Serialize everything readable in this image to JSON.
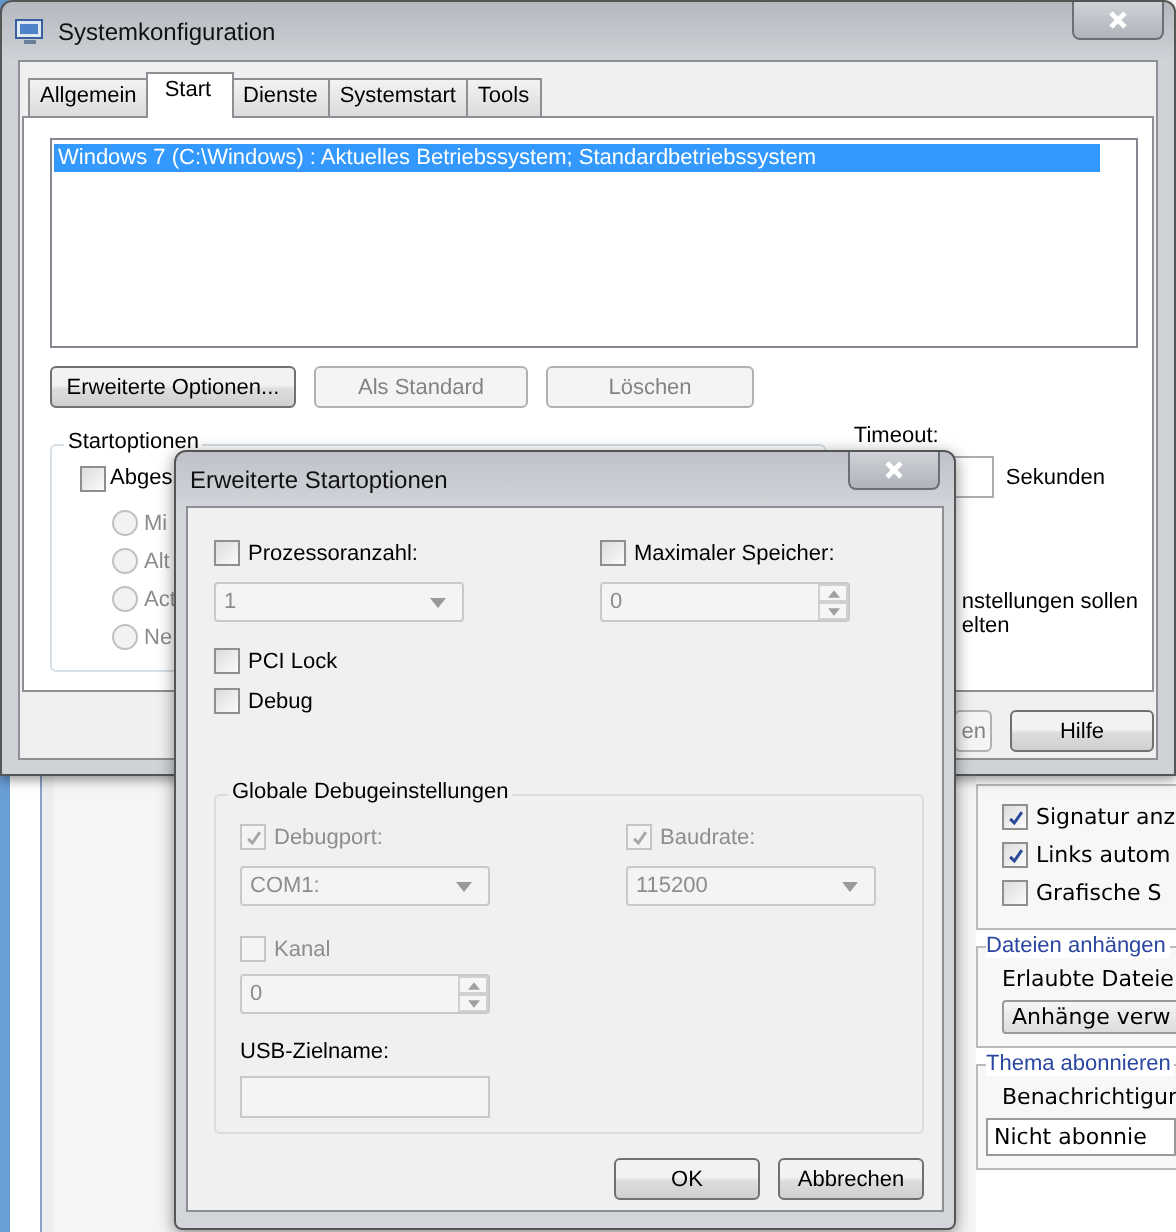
{
  "main_window": {
    "title": "Systemkonfiguration",
    "tabs": [
      {
        "label": "Allgemein",
        "selected": false
      },
      {
        "label": "Start",
        "selected": true
      },
      {
        "label": "Dienste",
        "selected": false
      },
      {
        "label": "Systemstart",
        "selected": false
      },
      {
        "label": "Tools",
        "selected": false
      }
    ],
    "boot_list": [
      {
        "text": "Windows 7 (C:\\Windows) : Aktuelles Betriebssystem; Standardbetriebssystem",
        "selected": true
      }
    ],
    "list_buttons": [
      {
        "label": "Erweiterte Optionen...",
        "disabled": false
      },
      {
        "label": "Als Standard",
        "disabled": true
      },
      {
        "label": "Löschen",
        "disabled": true
      }
    ],
    "boot_options": {
      "title": "Startoptionen",
      "safe_boot": {
        "label": "Abges",
        "checked": false
      },
      "modes": [
        {
          "label": "Mi",
          "selected": false,
          "disabled": true
        },
        {
          "label": "Alt",
          "selected": false,
          "disabled": true
        },
        {
          "label": "Act",
          "selected": false,
          "disabled": true
        },
        {
          "label": "Ne",
          "selected": false,
          "disabled": true
        }
      ]
    },
    "timeout": {
      "label": "Timeout:",
      "unit": "Sekunden"
    },
    "persist_note": [
      "nstellungen sollen",
      "elten"
    ],
    "buttons": [
      {
        "label": "en",
        "disabled": true
      },
      {
        "label": "Hilfe",
        "disabled": false
      }
    ]
  },
  "dialog": {
    "title": "Erweiterte Startoptionen",
    "processor": {
      "label": "Prozessoranzahl:",
      "checked": false,
      "value": "1",
      "disabled": true
    },
    "memory": {
      "label": "Maximaler Speicher:",
      "checked": false,
      "value": "0",
      "disabled": true
    },
    "flags": [
      {
        "label": "PCI Lock",
        "checked": false
      },
      {
        "label": "Debug",
        "checked": false
      }
    ],
    "debug_settings": {
      "title": "Globale Debugeinstellungen",
      "debugport": {
        "label": "Debugport:",
        "checked": true,
        "disabled": true,
        "value": "COM1:"
      },
      "baudrate": {
        "label": "Baudrate:",
        "checked": true,
        "disabled": true,
        "value": "115200"
      },
      "channel": {
        "label": "Kanal",
        "checked": false,
        "disabled": true,
        "value": "0"
      },
      "usb_target": {
        "label": "USB-Zielname:",
        "disabled": true
      }
    },
    "buttons": [
      {
        "label": "OK"
      },
      {
        "label": "Abbrechen"
      }
    ]
  },
  "background_page": {
    "options": [
      {
        "label": "Signatur anz",
        "checked": true
      },
      {
        "label": "Links autom",
        "checked": true
      },
      {
        "label": "Grafische S",
        "checked": false
      }
    ],
    "attachments": {
      "title": "Dateien anhängen",
      "text": "Erlaubte Dateie",
      "button": "Anhänge verw"
    },
    "subscribe": {
      "title": "Thema abonnieren",
      "text": "Benachrichtigur",
      "value": "Nicht abonnie"
    }
  }
}
